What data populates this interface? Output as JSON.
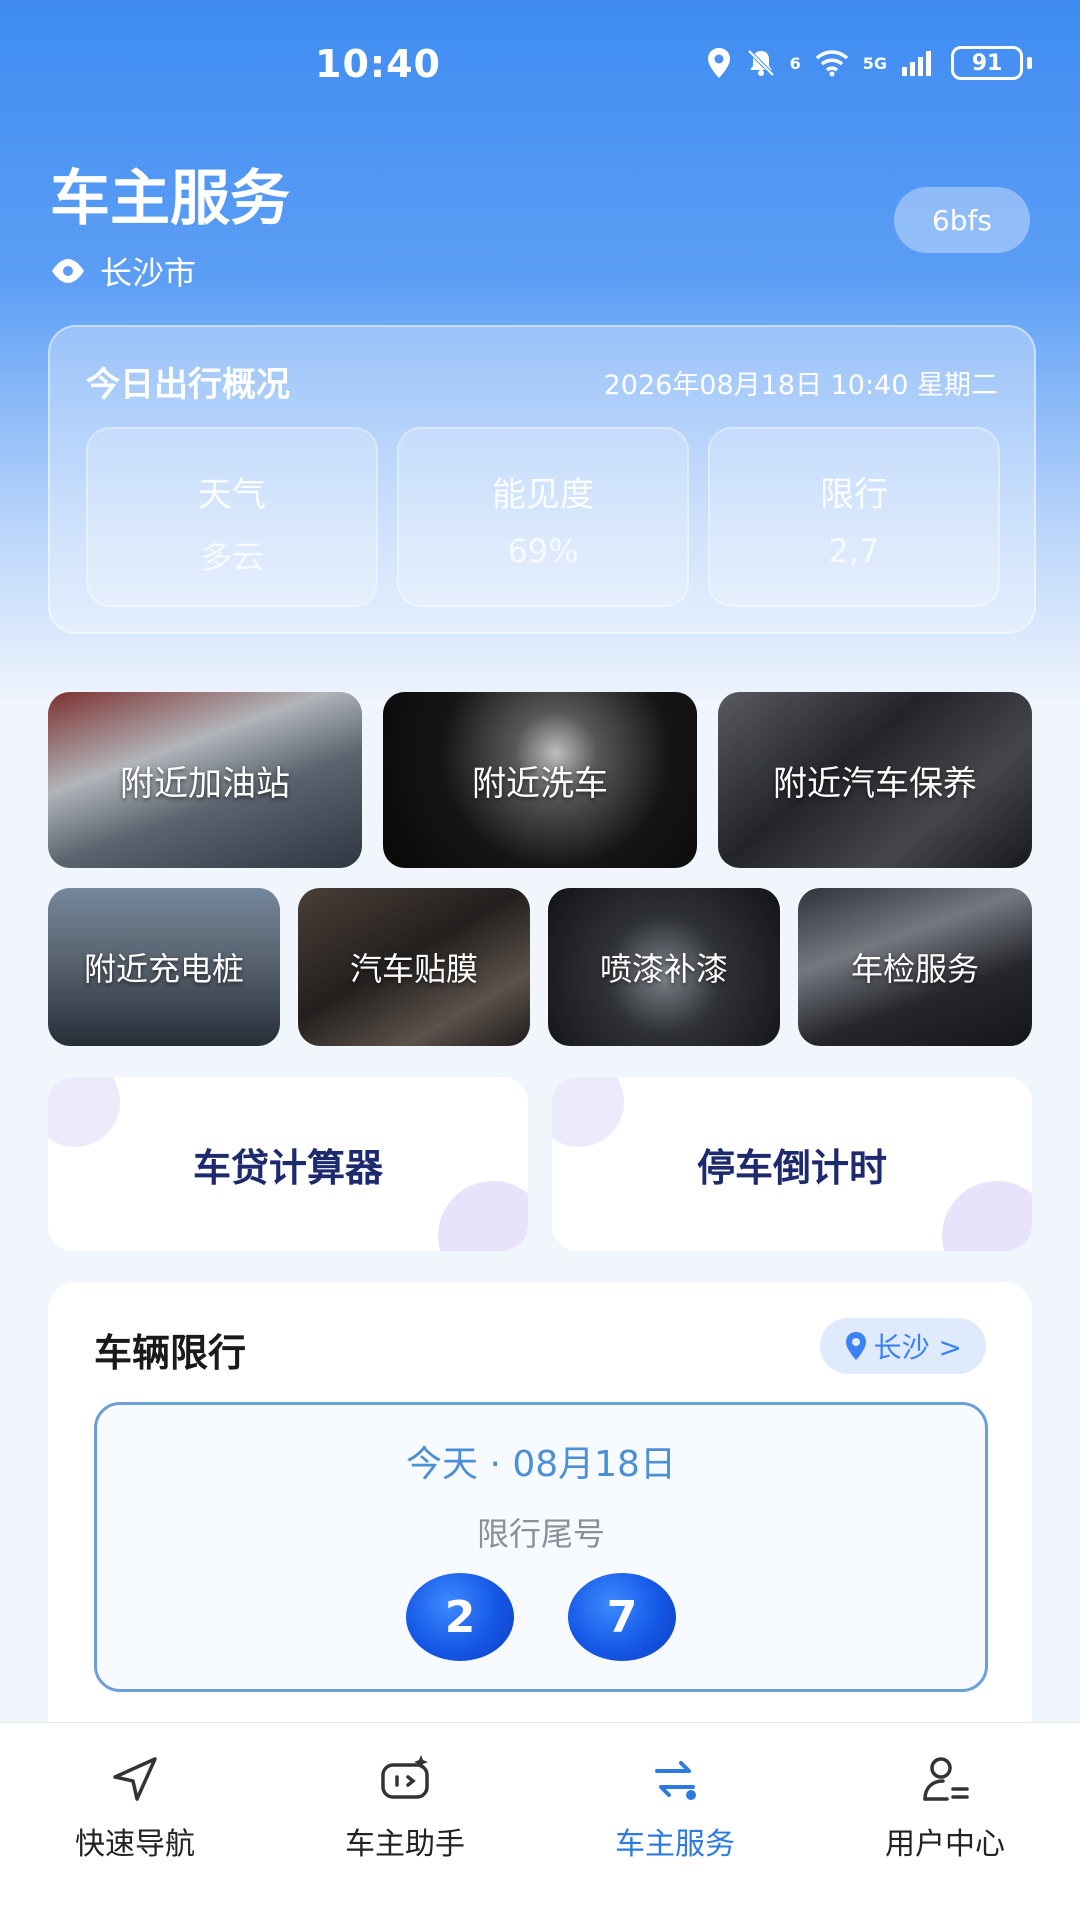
{
  "status_bar": {
    "time": "10:40",
    "battery": "91",
    "network": "5G",
    "signal_small": "6"
  },
  "header": {
    "title": "车主服务",
    "city": "长沙市",
    "badge": "6bfs"
  },
  "overview": {
    "title": "今日出行概况",
    "datetime": "2026年08月18日 10:40 星期二",
    "items": [
      {
        "label": "天气",
        "value": "多云"
      },
      {
        "label": "能见度",
        "value": "69%"
      },
      {
        "label": "限行",
        "value": "2,7"
      }
    ]
  },
  "services_row1": [
    {
      "label": "附近加油站"
    },
    {
      "label": "附近洗车"
    },
    {
      "label": "附近汽车保养"
    }
  ],
  "services_row2": [
    {
      "label": "附近充电桩"
    },
    {
      "label": "汽车贴膜"
    },
    {
      "label": "喷漆补漆"
    },
    {
      "label": "年检服务"
    }
  ],
  "tools": [
    {
      "label": "车贷计算器"
    },
    {
      "label": "停车倒计时"
    }
  ],
  "restriction": {
    "title": "车辆限行",
    "city_chip": "长沙 >",
    "date": "今天 · 08月18日",
    "subtitle": "限行尾号",
    "numbers": [
      "2",
      "7"
    ]
  },
  "tabbar": [
    {
      "label": "快速导航",
      "icon": "navigation-arrow-icon",
      "active": false
    },
    {
      "label": "车主助手",
      "icon": "assistant-bot-icon",
      "active": false
    },
    {
      "label": "车主服务",
      "icon": "service-swap-icon",
      "active": true
    },
    {
      "label": "用户中心",
      "icon": "user-profile-icon",
      "active": false
    }
  ],
  "colors": {
    "primary": "#3f8cf2",
    "accent_blue": "#2d7be0",
    "tool_text": "#1d2a6e"
  }
}
